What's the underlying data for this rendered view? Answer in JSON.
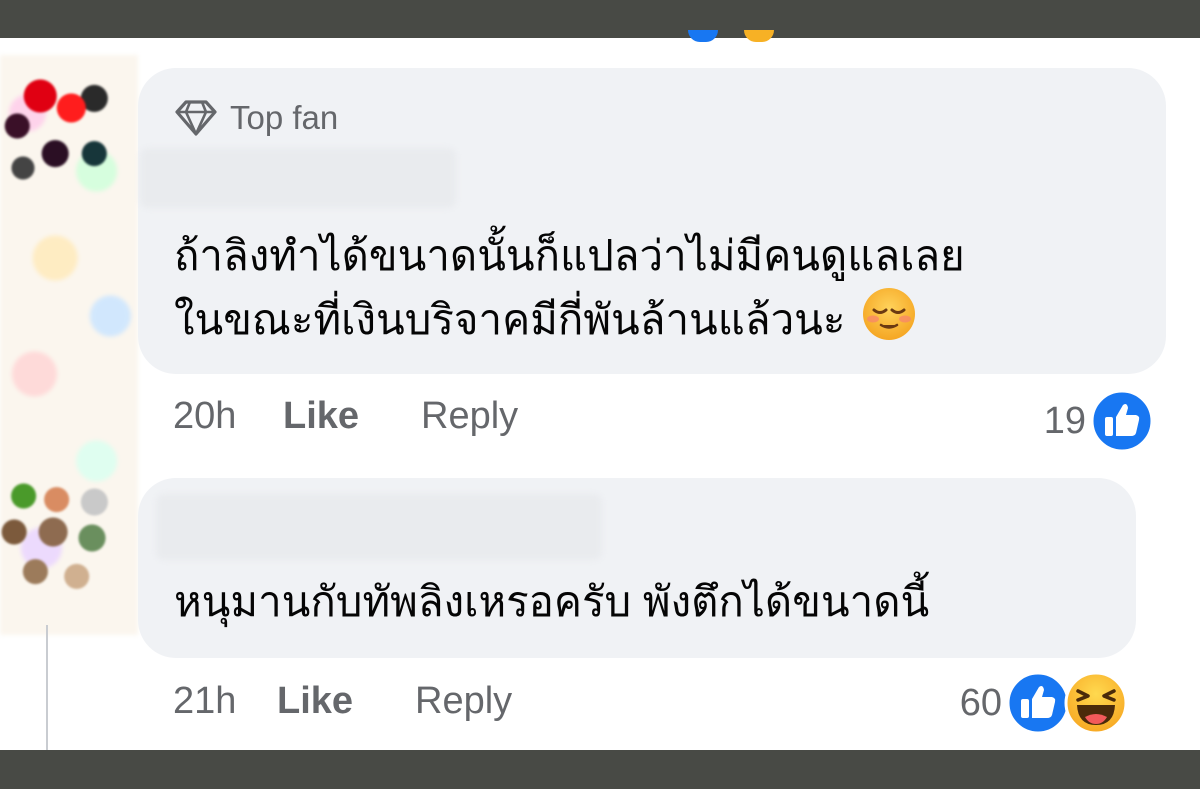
{
  "comments": [
    {
      "badge": "Top fan",
      "text_line1": "ถ้าลิงทำได้ขนาดนั้นก็แปลว่าไม่มีคนดูแลเลย",
      "text_line2": "ในขณะที่เงินบริจาคมีกี่พันล้านแล้วนะ",
      "time": "20h",
      "like_label": "Like",
      "reply_label": "Reply",
      "reaction_count": "19",
      "reactions": [
        "like-icon"
      ],
      "emoji": "relieved-face-icon"
    },
    {
      "text": "หนุมานกับทัพลิงเหรอครับ พังตึกได้ขนาดนี้",
      "time": "21h",
      "like_label": "Like",
      "reply_label": "Reply",
      "reaction_count": "60",
      "reactions": [
        "like-icon",
        "haha-icon"
      ]
    }
  ],
  "colors": {
    "bubble": "#f0f2f5",
    "secondary_text": "#65676b",
    "like_blue": "#1877f2",
    "haha_yellow": "#f7b125",
    "frame": "#484a45"
  }
}
